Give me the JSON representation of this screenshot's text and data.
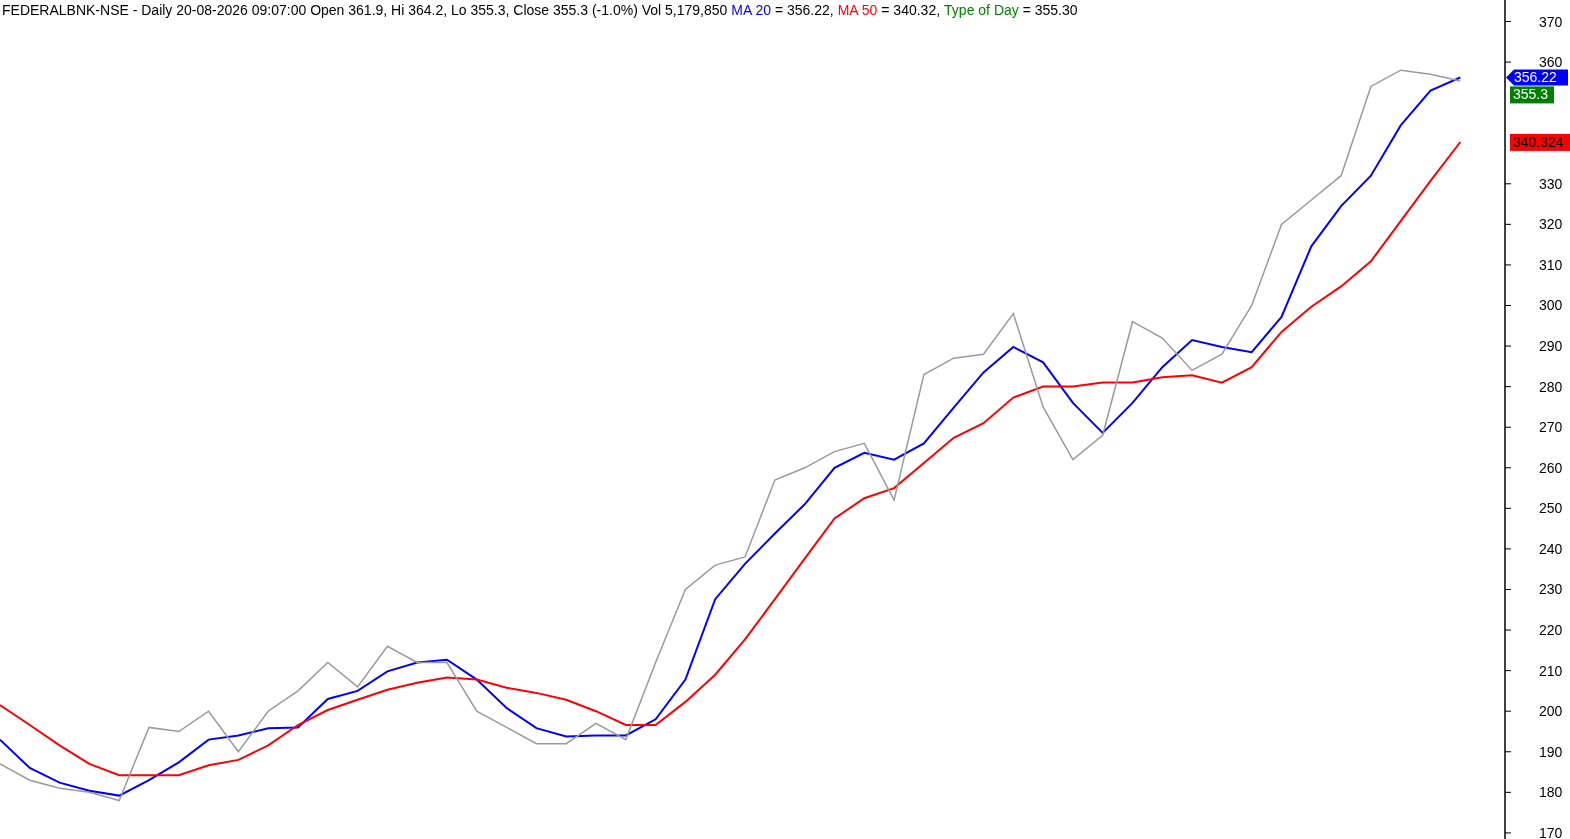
{
  "header": {
    "info": "FEDERALBNK-NSE - Daily 20-08-2026 09:07:00 Open 361.9, Hi 364.2, Lo 355.3, Close 355.3 (-1.0%) Vol 5,179,850",
    "indicators": [
      {
        "value": "= 356.22,",
        "color": "#0000ff"
      },
      {
        "value": "= 340.32,",
        "color": "#ff0000"
      },
      {
        "value": "= 355.30",
        "color": "#008000"
      }
    ]
  },
  "chart_data": {
    "type": "line",
    "ylim": [
      168.5,
      375.3
    ],
    "yticks": [
      170,
      180,
      190,
      200,
      210,
      220,
      230,
      240,
      250,
      260,
      270,
      280,
      290,
      300,
      310,
      320,
      330,
      360,
      370
    ],
    "series": [
      {
        "name": "MA 20",
        "color": "#0000ff",
        "values": [
          193,
          186,
          182.4,
          180.4,
          179.2,
          183,
          187.4,
          193,
          194,
          195.8,
          196,
          203,
          205,
          209.8,
          212,
          212.7,
          207.8,
          200.8,
          195.8,
          193.8,
          194,
          194,
          198,
          207.8,
          227.6,
          236.3,
          243.8,
          251,
          260,
          263.7,
          262,
          266,
          274.8,
          283.5,
          289.8,
          286,
          276,
          268.6,
          276,
          284.8,
          291.5,
          289.8,
          288.5,
          297.2,
          314.6,
          324.5,
          332,
          344.4,
          353,
          356.2
        ]
      },
      {
        "name": "MA 50",
        "color": "#ff0000",
        "values": [
          201.5,
          196.6,
          191.6,
          187,
          184.2,
          184.2,
          184.2,
          186.7,
          188,
          191.6,
          196.6,
          200.3,
          202.8,
          205.3,
          207,
          208.3,
          207.8,
          205.8,
          204.5,
          202.8,
          200,
          196.6,
          196.6,
          202.3,
          209,
          217.7,
          227.6,
          237.6,
          247.5,
          252.5,
          255,
          261.2,
          267.4,
          271,
          277.3,
          280,
          280,
          281,
          281,
          282.3,
          282.8,
          281,
          284.8,
          293.5,
          299.7,
          304.7,
          310.9,
          320.8,
          330.7,
          340.3
        ]
      },
      {
        "name": "Type of Day",
        "color": "#9a9a9a",
        "values": [
          187,
          183,
          181,
          180,
          178,
          196,
          195,
          200,
          190,
          200,
          205,
          212,
          206,
          216,
          212,
          212,
          200,
          196,
          192,
          192,
          197,
          193,
          212,
          230,
          236,
          238,
          257,
          260,
          264,
          266,
          252,
          283,
          287,
          288,
          298,
          275,
          262,
          268,
          296,
          292,
          284,
          288,
          300,
          320,
          326,
          332,
          354,
          358,
          357,
          355.3
        ]
      }
    ]
  },
  "price_markers": [
    {
      "kind": "flag",
      "text": "356.22",
      "color": "#0000ff"
    },
    {
      "kind": "label",
      "text": "355.3",
      "color": "#008000"
    },
    {
      "kind": "label",
      "text": "340.324",
      "color": "#ff0000"
    }
  ]
}
